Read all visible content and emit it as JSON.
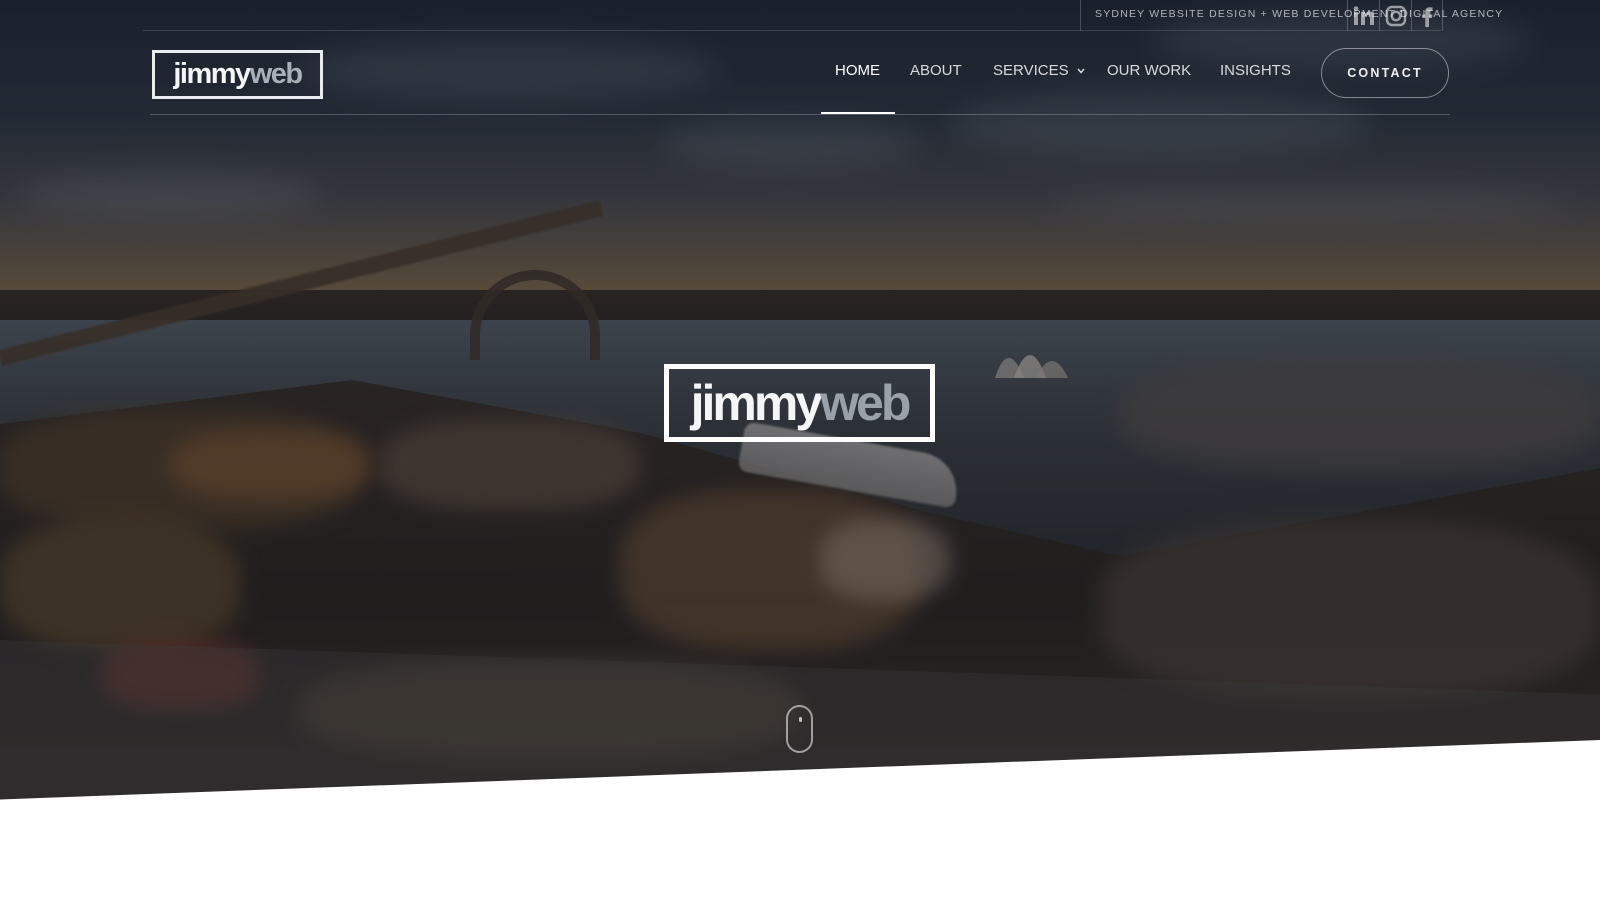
{
  "topbar": {
    "tagline": "SYDNEY WEBSITE DESIGN + WEB DEVELOPMENT DIGITAL AGENCY",
    "social": [
      {
        "icon": "linkedin-icon"
      },
      {
        "icon": "instagram-icon"
      },
      {
        "icon": "facebook-icon"
      }
    ]
  },
  "header": {
    "logo": {
      "part1": "jimmy",
      "part2": "web"
    },
    "nav": [
      {
        "label": "HOME",
        "active": true
      },
      {
        "label": "ABOUT"
      },
      {
        "label": "SERVICES",
        "has_dropdown": true
      },
      {
        "label": "OUR WORK"
      },
      {
        "label": "INSIGHTS"
      }
    ],
    "contact_label": "CONTACT"
  },
  "hero": {
    "logo": {
      "part1": "jimmy",
      "part2": "web"
    }
  },
  "colors": {
    "logo_primary": "#f3f5f7",
    "logo_secondary": "#a9b0b8",
    "nav_text": "#ffffff"
  }
}
